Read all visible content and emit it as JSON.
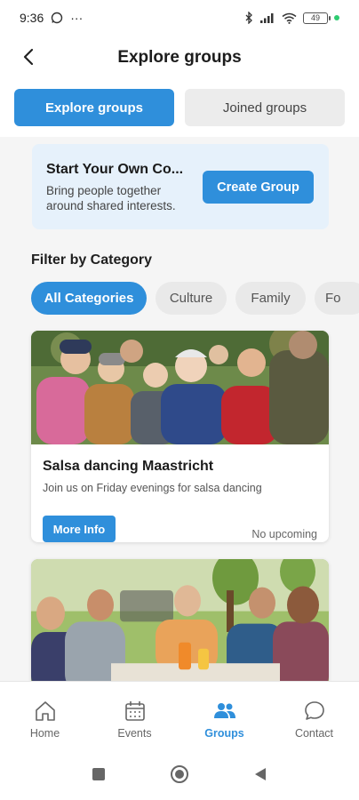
{
  "status_bar": {
    "time": "9:36",
    "extra": "···",
    "battery": "49"
  },
  "header": {
    "title": "Explore groups"
  },
  "tabs": [
    {
      "label": "Explore groups",
      "active": true
    },
    {
      "label": "Joined groups",
      "active": false
    }
  ],
  "create_card": {
    "title": "Start Your Own Co...",
    "description": "Bring people together around shared interests.",
    "button_label": "Create Group"
  },
  "filter": {
    "label": "Filter by Category",
    "chips": [
      "All Categories",
      "Culture",
      "Family",
      "Fo"
    ]
  },
  "groups": [
    {
      "title": "Salsa dancing Maastricht",
      "description": "Join us on Friday evenings for salsa dancing",
      "button_label": "More Info",
      "status": "No upcoming"
    }
  ],
  "bottom_nav": [
    {
      "label": "Home",
      "icon": "home-icon",
      "active": false
    },
    {
      "label": "Events",
      "icon": "calendar-icon",
      "active": false
    },
    {
      "label": "Groups",
      "icon": "groups-icon",
      "active": true
    },
    {
      "label": "Contact",
      "icon": "chat-icon",
      "active": false
    }
  ],
  "colors": {
    "accent": "#2f8fdb",
    "card_bg": "#e6f1fb",
    "chip_bg": "#e9e9e9"
  }
}
